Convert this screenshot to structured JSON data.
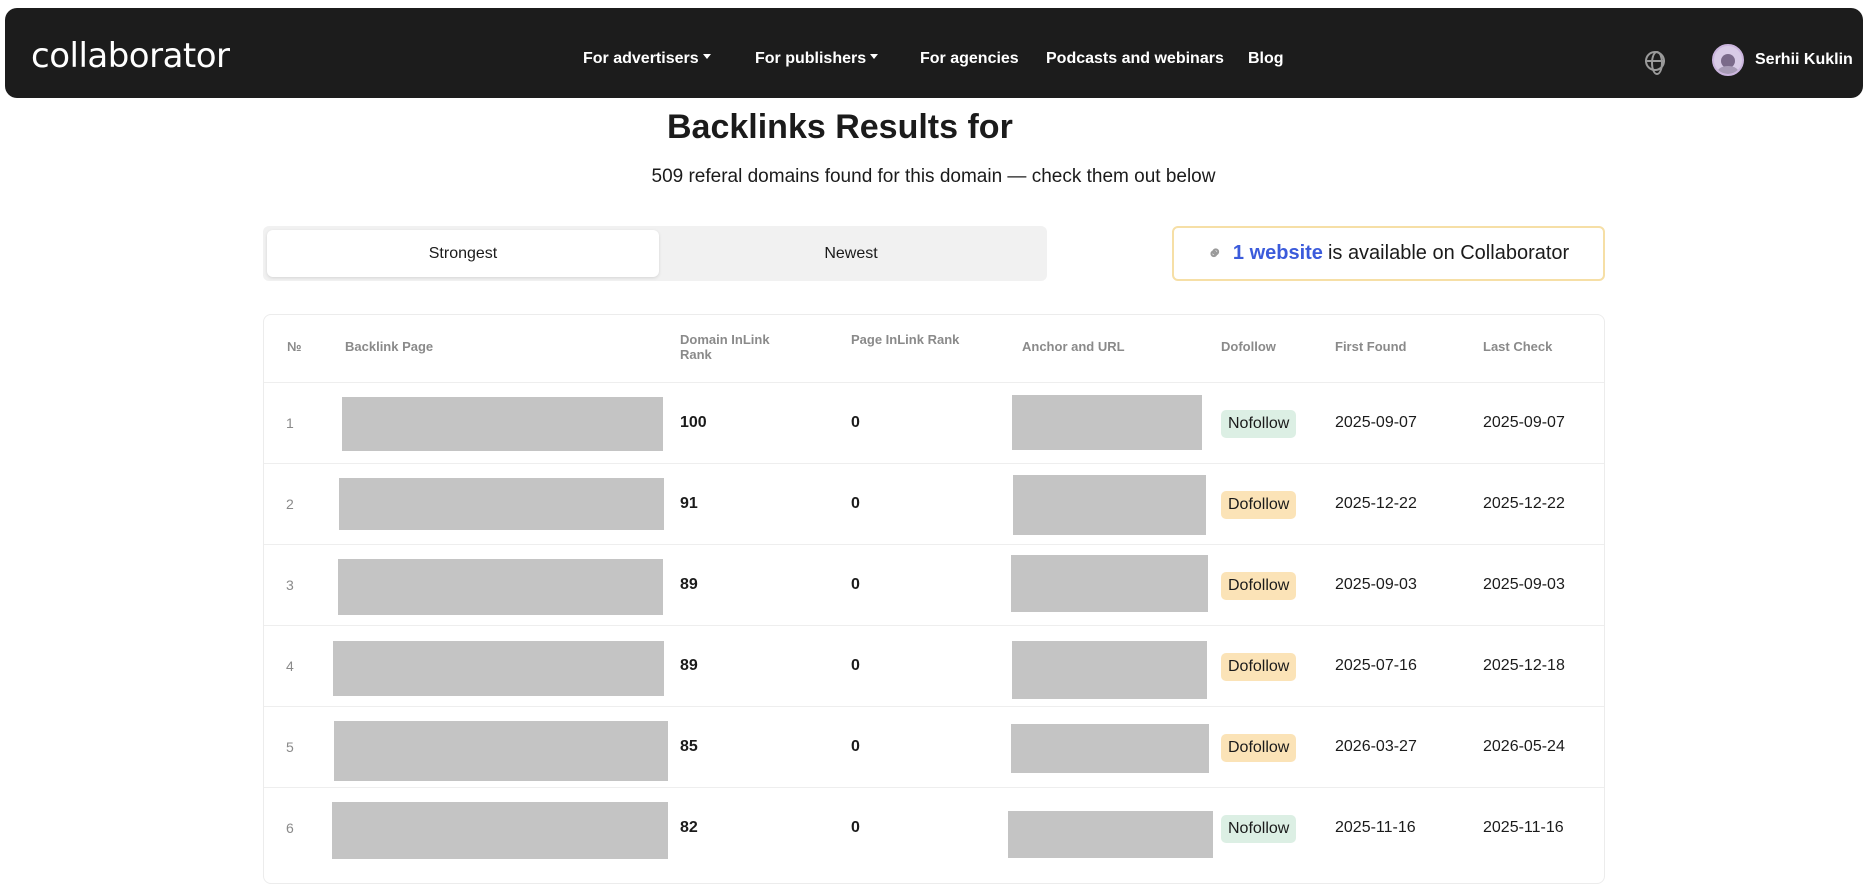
{
  "header": {
    "logo": "collaborator",
    "nav": [
      {
        "label": "For advertisers",
        "dropdown": true
      },
      {
        "label": "For publishers",
        "dropdown": true
      },
      {
        "label": "For agencies",
        "dropdown": false
      },
      {
        "label": "Podcasts and webinars",
        "dropdown": false
      },
      {
        "label": "Blog",
        "dropdown": false
      }
    ],
    "globe_icon": "globe-icon",
    "user_name": "Serhii Kuklin"
  },
  "page": {
    "title": "Backlinks Results for",
    "subtitle": "509 referal domains found for this domain — check them out below"
  },
  "tabs": [
    {
      "label": "Strongest",
      "active": true
    },
    {
      "label": "Newest",
      "active": false
    }
  ],
  "availability": {
    "icon": "link-icon",
    "link_text": "1 website",
    "text": "is available on Collaborator"
  },
  "table": {
    "headers": [
      "№",
      "Backlink Page",
      "Domain InLink Rank",
      "Page InLink Rank",
      "Anchor and URL",
      "Dofollow",
      "First Found",
      "Last Check"
    ],
    "rows": [
      {
        "n": "1",
        "domain_rank": "100",
        "page_rank": "0",
        "follow": "Nofollow",
        "first_found": "2025-09-07",
        "last_check": "2025-09-07"
      },
      {
        "n": "2",
        "domain_rank": "91",
        "page_rank": "0",
        "follow": "Dofollow",
        "first_found": "2025-12-22",
        "last_check": "2025-12-22"
      },
      {
        "n": "3",
        "domain_rank": "89",
        "page_rank": "0",
        "follow": "Dofollow",
        "first_found": "2025-09-03",
        "last_check": "2025-09-03"
      },
      {
        "n": "4",
        "domain_rank": "89",
        "page_rank": "0",
        "follow": "Dofollow",
        "first_found": "2025-07-16",
        "last_check": "2025-12-18"
      },
      {
        "n": "5",
        "domain_rank": "85",
        "page_rank": "0",
        "follow": "Dofollow",
        "first_found": "2026-03-27",
        "last_check": "2026-05-24"
      },
      {
        "n": "6",
        "domain_rank": "82",
        "page_rank": "0",
        "follow": "Nofollow",
        "first_found": "2025-11-16",
        "last_check": "2025-11-16"
      }
    ]
  },
  "colors": {
    "header_bg": "#1c1c1c",
    "link_blue": "#3b5bdb",
    "nofollow_bg": "#dcefe4",
    "dofollow_bg": "#fbe3b7",
    "redacted": "#c4c4c4"
  }
}
